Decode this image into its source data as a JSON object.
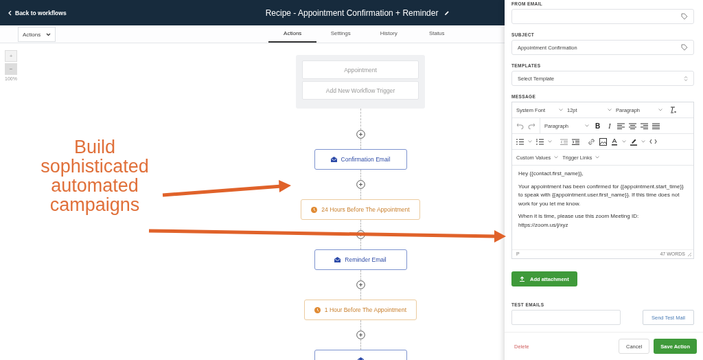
{
  "header": {
    "back_link": "Back to workflows",
    "title": "Recipe - Appointment Confirmation + Reminder"
  },
  "toolbar": {
    "actions_dropdown": "Actions",
    "tabs": [
      {
        "label": "Actions",
        "selected": true
      },
      {
        "label": "Settings",
        "selected": false
      },
      {
        "label": "History",
        "selected": false
      },
      {
        "label": "Status",
        "selected": false
      }
    ]
  },
  "zoom_controls": {
    "zoom_in": "+",
    "zoom_out": "−",
    "level_text": "100%"
  },
  "trigger": {
    "items": [
      "Appointment",
      "Add New Workflow Trigger"
    ]
  },
  "steps": [
    {
      "kind": "email",
      "label": "Confirmation Email"
    },
    {
      "kind": "delay",
      "label": "24 Hours Before The Appointment"
    },
    {
      "kind": "email",
      "label": "Reminder Email"
    },
    {
      "kind": "delay",
      "label": "1 Hour Before The Appointment"
    },
    {
      "kind": "email"
    }
  ],
  "annotation": {
    "text": "Build sophisticated automated campaigns"
  },
  "panel": {
    "from_email": {
      "label": "FROM EMAIL"
    },
    "subject": {
      "label": "SUBJECT",
      "value": "Appointment Confirmation"
    },
    "templates": {
      "label": "TEMPLATES",
      "placeholder": "Select Template"
    },
    "message": {
      "label": "MESSAGE",
      "font_select": "System Font",
      "size_select": "12pt",
      "block_select": "Paragraph",
      "format_select": "Paragraph",
      "bold": "B",
      "italic": "I",
      "custom_values": "Custom Values",
      "trigger_links": "Trigger Links",
      "body": [
        "Hey {{contact.first_name}},",
        "Your appointment has been confirmed for {{appointment.start_time}} to speak with {{appointment.user.first_name}}. If this time does not work for you let me know.",
        "When it is time, please use this zoom Meeting ID: https://zoom.us/j/xyz"
      ],
      "status_path": "P",
      "word_count": "47 WORDS"
    },
    "attach_button": "Add attachment",
    "test_emails": {
      "label": "TEST EMAILS",
      "send_button": "Send Test Mail"
    },
    "footer": {
      "delete": "Delete",
      "cancel": "Cancel",
      "save": "Save Action"
    }
  }
}
